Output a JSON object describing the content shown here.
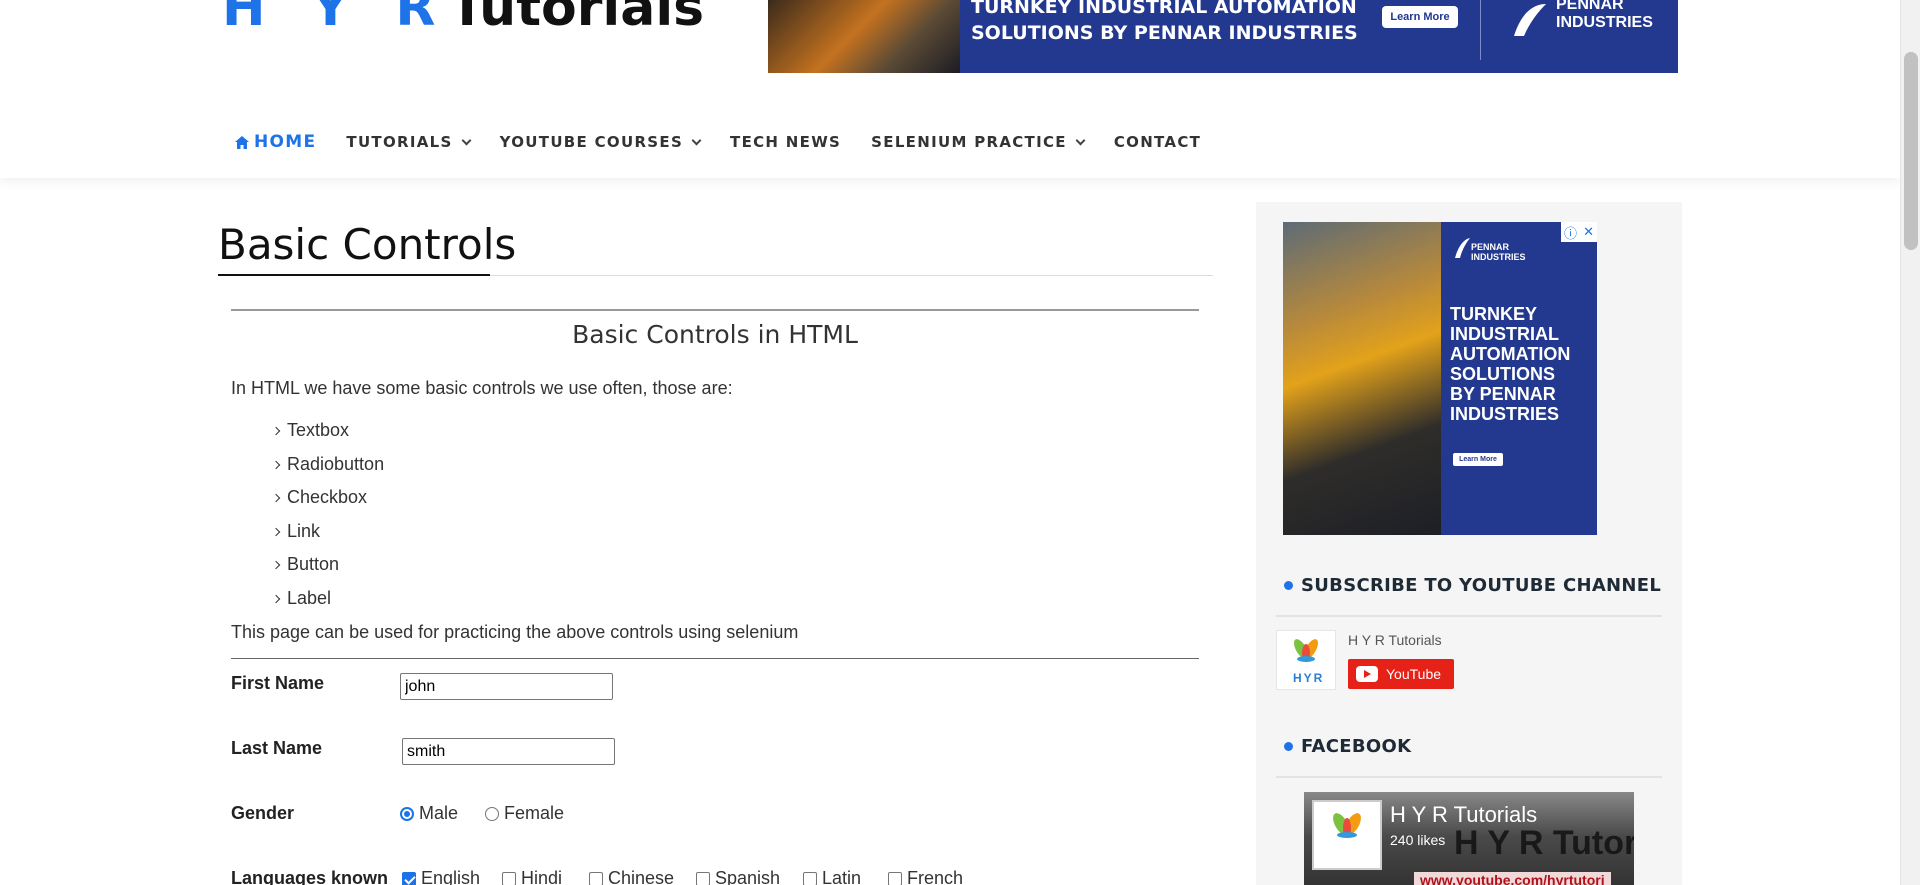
{
  "header": {
    "logo_part1": "H Y R",
    "logo_part2": "Tutorials",
    "ad": {
      "headline": "TURNKEY INDUSTRIAL AUTOMATION\nSOLUTIONS BY PENNAR INDUSTRIES",
      "button": "Learn More",
      "brand": "PENNAR\nINDUSTRIES"
    }
  },
  "nav": {
    "items": [
      {
        "label": "HOME",
        "active": true,
        "icon": "home-icon"
      },
      {
        "label": "TUTORIALS",
        "dropdown": true
      },
      {
        "label": "YOUTUBE COURSES",
        "dropdown": true
      },
      {
        "label": "TECH NEWS",
        "dropdown": false
      },
      {
        "label": "SELENIUM PRACTICE",
        "dropdown": true
      },
      {
        "label": "CONTACT",
        "dropdown": false
      }
    ]
  },
  "main": {
    "title": "Basic Controls",
    "subtitle": "Basic Controls in HTML",
    "intro": "In HTML we have some basic controls we use often, those are:",
    "controls": [
      "Textbox",
      "Radiobutton",
      "Checkbox",
      "Link",
      "Button",
      "Label"
    ],
    "outro": "This page can be used for practicing the above controls using selenium"
  },
  "form": {
    "first_name_label": "First Name",
    "first_name_value": "john",
    "last_name_label": "Last Name",
    "last_name_value": "smith",
    "gender_label": "Gender",
    "gender_options": [
      {
        "label": "Male",
        "checked": true
      },
      {
        "label": "Female",
        "checked": false
      }
    ],
    "languages_label": "Languages known",
    "languages": [
      {
        "label": "English",
        "checked": true
      },
      {
        "label": "Hindi",
        "checked": false
      },
      {
        "label": "Chinese",
        "checked": false
      },
      {
        "label": "Spanish",
        "checked": false
      },
      {
        "label": "Latin",
        "checked": false
      },
      {
        "label": "French",
        "checked": false
      }
    ]
  },
  "sidebar": {
    "ad": {
      "brand": "PENNAR\nINDUSTRIES",
      "headline": "TURNKEY\nINDUSTRIAL\nAUTOMATION\nSOLUTIONS\nBY PENNAR\nINDUSTRIES",
      "button": "Learn More"
    },
    "youtube_title": "SUBSCRIBE TO YOUTUBE CHANNEL",
    "youtube_channel": "H Y R Tutorials",
    "youtube_button": "YouTube",
    "logo_text": "HYR",
    "facebook_title": "FACEBOOK",
    "facebook_page_name": "H Y R Tutorials",
    "facebook_likes": "240 likes",
    "facebook_cover_text": "H Y R Tutoria",
    "facebook_url": "www.youtube.com/hyrtutori"
  },
  "colors": {
    "accent": "#1e73e8",
    "ad_blue": "#23388f",
    "youtube_red": "#e62117"
  }
}
